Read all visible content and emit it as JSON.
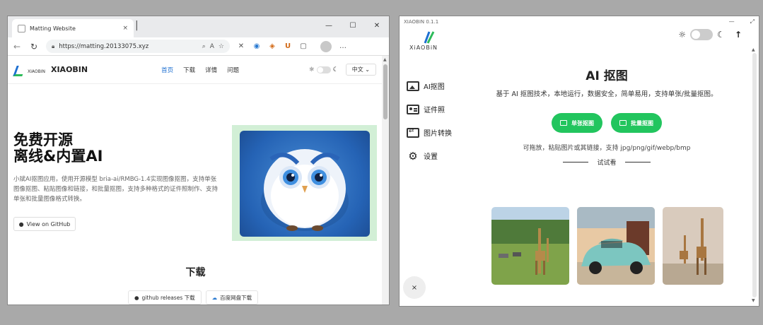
{
  "browser": {
    "tab_title": "Matting Website",
    "tab_close": "×",
    "new_tab": "|",
    "win_min": "—",
    "win_max": "☐",
    "win_close": "✕",
    "url": "https://matting.20133075.xyz",
    "icons": [
      "back-icon",
      "refresh-icon",
      "lock-icon",
      "zoom-icon",
      "read-aloud-icon",
      "favorite-icon",
      "extensions-icon",
      "profile-icon"
    ]
  },
  "site": {
    "brand": "XIAOBIN",
    "logo_sub": "XIAOBIN",
    "nav": [
      "首页",
      "下载",
      "详情",
      "问题"
    ],
    "language": "中文",
    "hero_title_line1": "免费开源",
    "hero_title_line2": "离线&内置AI",
    "hero_desc": "小斌AI抠图应用，使用开源模型 bria-ai/RMBG-1.4实现图像抠图，支持单张图像抠图、粘贴图像和链接，和批量抠图，支持多种格式的证件照制作、支持单张和批量图像格式转换。",
    "github_button": "View on GitHub",
    "download_title": "下载",
    "download_buttons": [
      "github releases 下载",
      "百度网盘下载"
    ]
  },
  "app": {
    "titlebar": "XIAOBIN   0.1.1",
    "logo_text": "XiAOBiN",
    "sidebar": [
      {
        "label": "AI抠图",
        "icon": "image-icon"
      },
      {
        "label": "证件照",
        "icon": "id-card-icon"
      },
      {
        "label": "图片转换",
        "icon": "convert-icon"
      },
      {
        "label": "设置",
        "icon": "gear-icon"
      }
    ],
    "title": "AI 抠图",
    "description": "基于 AI 抠图技术，本地运行，数据安全，简单易用，支持单张/批量抠图。",
    "single_button": "单张抠图",
    "batch_button": "批量抠图",
    "hint": "可拖放，粘贴图片或其链接，支持 jpg/png/gif/webp/bmp",
    "try_label": "试试看",
    "close_label": "×",
    "samples": [
      "giraffes-savanna-photo",
      "vintage-car-photo",
      "giraffes-desert-photo"
    ]
  }
}
